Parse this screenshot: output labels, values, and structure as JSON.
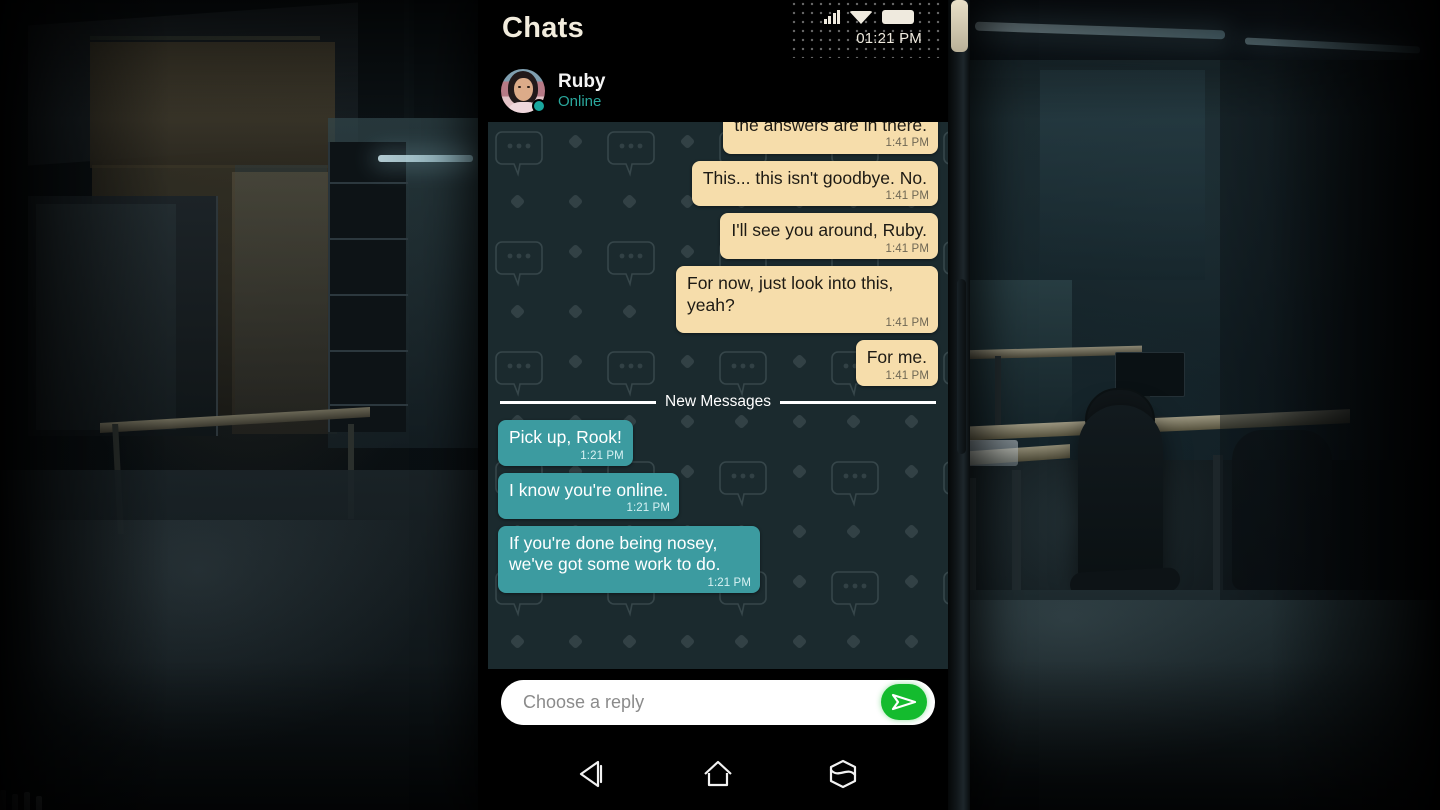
{
  "app": {
    "title": "Chats"
  },
  "status_bar": {
    "time": "01:21 PM",
    "icons": [
      "signal-icon",
      "wifi-icon",
      "battery-icon"
    ]
  },
  "contact": {
    "name": "Ruby",
    "status": "Online",
    "avatar": "ruby-avatar",
    "presence_color": "#19a79e"
  },
  "chat": {
    "background_color": "#1b2a2e",
    "incoming_bubble_color": "#3c9ba0",
    "outgoing_bubble_color": "#f6ddab",
    "divider": {
      "label": "New Messages"
    },
    "messages": [
      {
        "id": "m0",
        "side": "out",
        "text": "the answers are in there.",
        "time": "1:41 PM",
        "clipped": true
      },
      {
        "id": "m1",
        "side": "out",
        "text": "This... this isn't goodbye. No.",
        "time": "1:41 PM",
        "clipped": false
      },
      {
        "id": "m2",
        "side": "out",
        "text": "I'll see you around, Ruby.",
        "time": "1:41 PM",
        "clipped": false
      },
      {
        "id": "m3",
        "side": "out",
        "text": "For now, just look into this, yeah?",
        "time": "1:41 PM",
        "clipped": false
      },
      {
        "id": "m4",
        "side": "out",
        "text": "For me.",
        "time": "1:41 PM",
        "clipped": false
      },
      {
        "id": "m5",
        "side": "in",
        "text": "Pick up, Rook!",
        "time": "1:21 PM",
        "clipped": false
      },
      {
        "id": "m6",
        "side": "in",
        "text": "I know you're online.",
        "time": "1:21 PM",
        "clipped": false
      },
      {
        "id": "m7",
        "side": "in",
        "text": "If you're done being nosey, we've got some work to do.",
        "time": "1:21 PM",
        "clipped": false
      }
    ]
  },
  "reply": {
    "placeholder": "Choose a reply",
    "value": "",
    "send_icon": "send-icon",
    "send_color": "#14bb2e"
  },
  "navigation": {
    "back_icon": "back-triangle-icon",
    "home_icon": "home-icon",
    "recents_icon": "recents-hexagon-icon"
  }
}
